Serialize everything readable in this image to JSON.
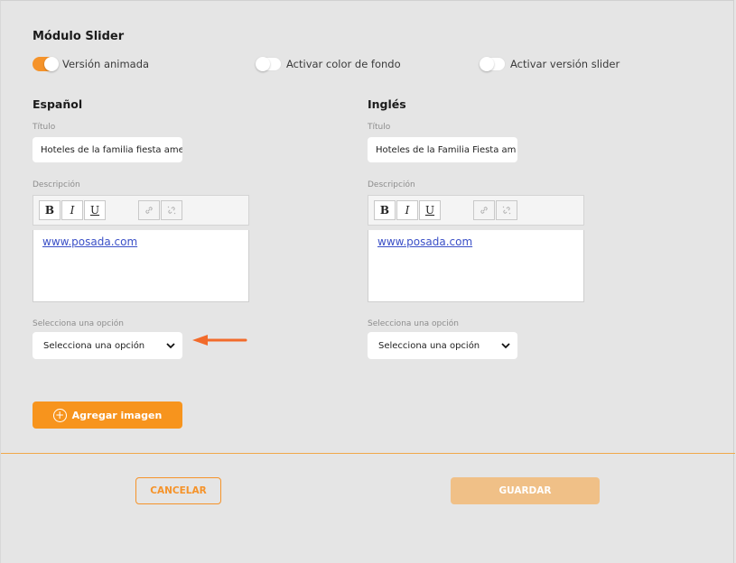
{
  "module": {
    "title": "Módulo Slider"
  },
  "toggles": [
    {
      "label": "Versión animada",
      "on": true
    },
    {
      "label": "Activar color de fondo",
      "on": false
    },
    {
      "label": "Activar versión slider",
      "on": false
    }
  ],
  "columns": {
    "es": {
      "title": "Español",
      "title_label": "Título",
      "title_value": "Hoteles de la familia fiesta ame",
      "description_label": "Descripción",
      "description_link": "www.posada.com",
      "select_label": "Selecciona una opción",
      "select_value": "Selecciona una opción"
    },
    "en": {
      "title": "Inglés",
      "title_label": "Título",
      "title_value": "Hoteles de la Familia Fiesta am",
      "description_label": "Descripción",
      "description_link": "www.posada.com",
      "select_label": "Selecciona una opción",
      "select_value": "Selecciona una opción"
    }
  },
  "toolbar": {
    "bold": "B",
    "italic": "I",
    "underline": "U"
  },
  "actions": {
    "add_image": "Agregar imagen",
    "cancel": "CANCELAR",
    "save": "GUARDAR"
  },
  "colors": {
    "accent": "#f5932a",
    "accent_disabled": "#f0c087",
    "arrow": "#f26b2b"
  },
  "icons": {
    "link": "link-icon",
    "unlink": "unlink-icon",
    "dropdown": "chevron-down-icon",
    "add": "plus-circle-icon",
    "pointer": "arrow-left-icon"
  }
}
